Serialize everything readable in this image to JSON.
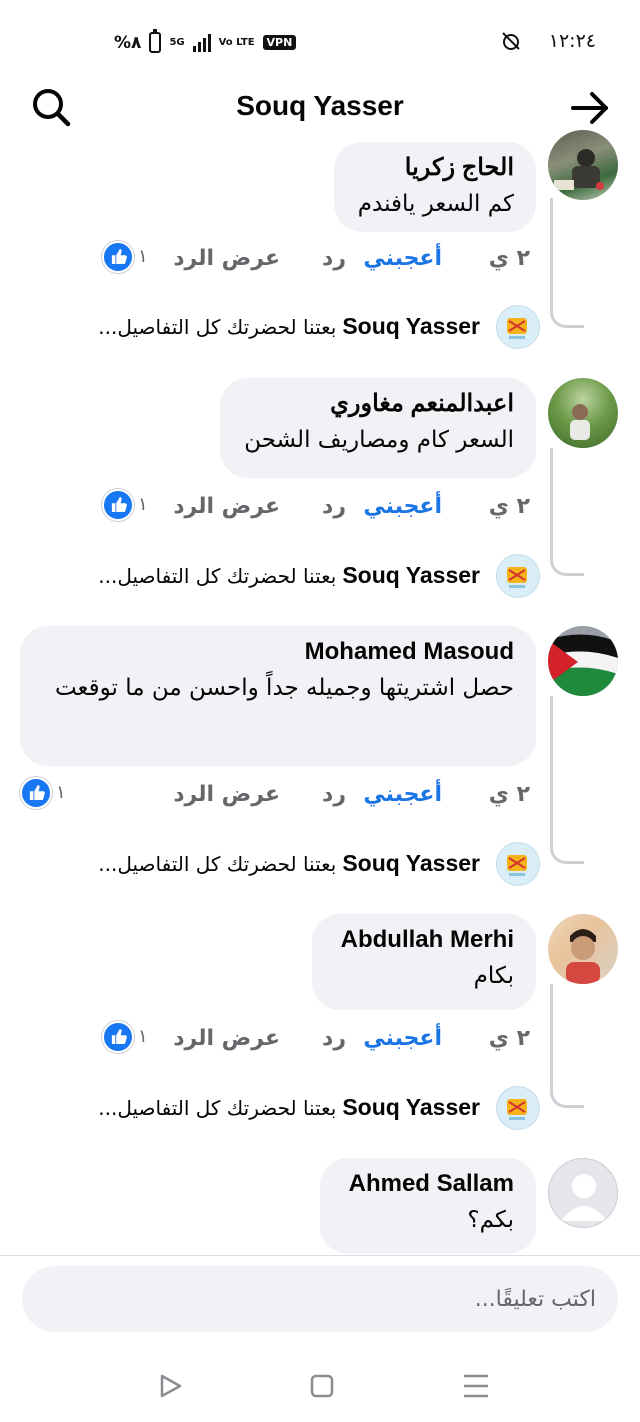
{
  "status_bar": {
    "battery": "%٨",
    "network": "5G",
    "volte": "Vo LTE",
    "vpn": "VPN",
    "time": "١٢:٢٤",
    "alarm_icon": "alarm-off-icon"
  },
  "header": {
    "title": "Souq Yasser",
    "search_icon": "search-icon",
    "back_icon": "arrow-right-icon"
  },
  "actions_labels": {
    "age": "٢ ي",
    "like": "أعجبني",
    "reply": "رد",
    "view_replies": "عرض الرد"
  },
  "comments": [
    {
      "name": "الحاج زكريا",
      "text": "كم السعر يافندم",
      "likes": "١",
      "reply": {
        "name": "Souq Yasser",
        "text": "بعتنا لحضرتك كل التفاصيل..."
      }
    },
    {
      "name": "اعبدالمنعم مغاوري",
      "text": "السعر كام ومصاريف الشحن",
      "likes": "١",
      "reply": {
        "name": "Souq Yasser",
        "text": "بعتنا لحضرتك كل التفاصيل..."
      }
    },
    {
      "name": "Mohamed Masoud",
      "text": "حصل اشتريتها وجميله جداً واحسن من ما توقعت",
      "likes": "١",
      "reply": {
        "name": "Souq Yasser",
        "text": "بعتنا لحضرتك كل التفاصيل..."
      }
    },
    {
      "name": "Abdullah Merhi",
      "text": "بكام",
      "likes": "١",
      "reply": {
        "name": "Souq Yasser",
        "text": "بعتنا لحضرتك كل التفاصيل..."
      }
    },
    {
      "name": "Ahmed Sallam",
      "text": "بكم؟"
    }
  ],
  "composer": {
    "placeholder": "اكتب تعليقًا..."
  },
  "navbar": {
    "back_icon": "nav-back-icon",
    "home_icon": "nav-home-icon",
    "menu_icon": "nav-menu-icon"
  },
  "colors": {
    "accent": "#1877f2",
    "bubble": "#f0f2f5",
    "muted": "#65676b"
  }
}
